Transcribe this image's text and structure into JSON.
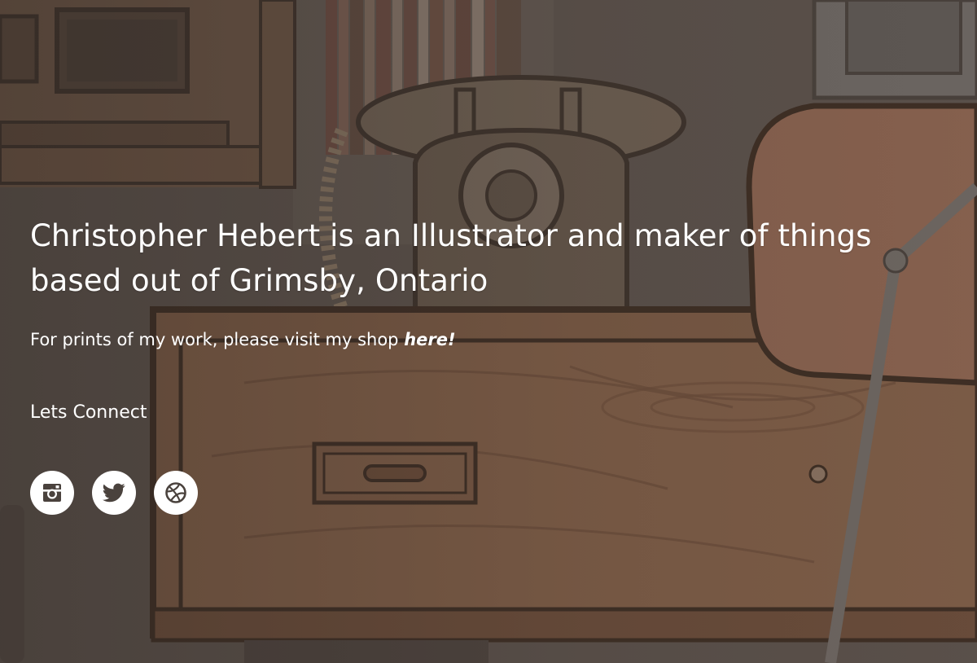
{
  "hero": {
    "headline": "Christopher Hebert is an Illustrator and maker of things based out of Grimsby, Ontario",
    "shop_text": "For prints of my work, please visit my shop ",
    "shop_link": "here!",
    "connect_label": "Lets Connect"
  },
  "social": [
    {
      "name": "instagram",
      "icon": "instagram-icon"
    },
    {
      "name": "twitter",
      "icon": "twitter-icon"
    },
    {
      "name": "dribbble",
      "icon": "dribbble-icon"
    }
  ],
  "colors": {
    "icon_fill": "#4a423d",
    "button_bg": "#ffffff",
    "text": "#ffffff"
  }
}
